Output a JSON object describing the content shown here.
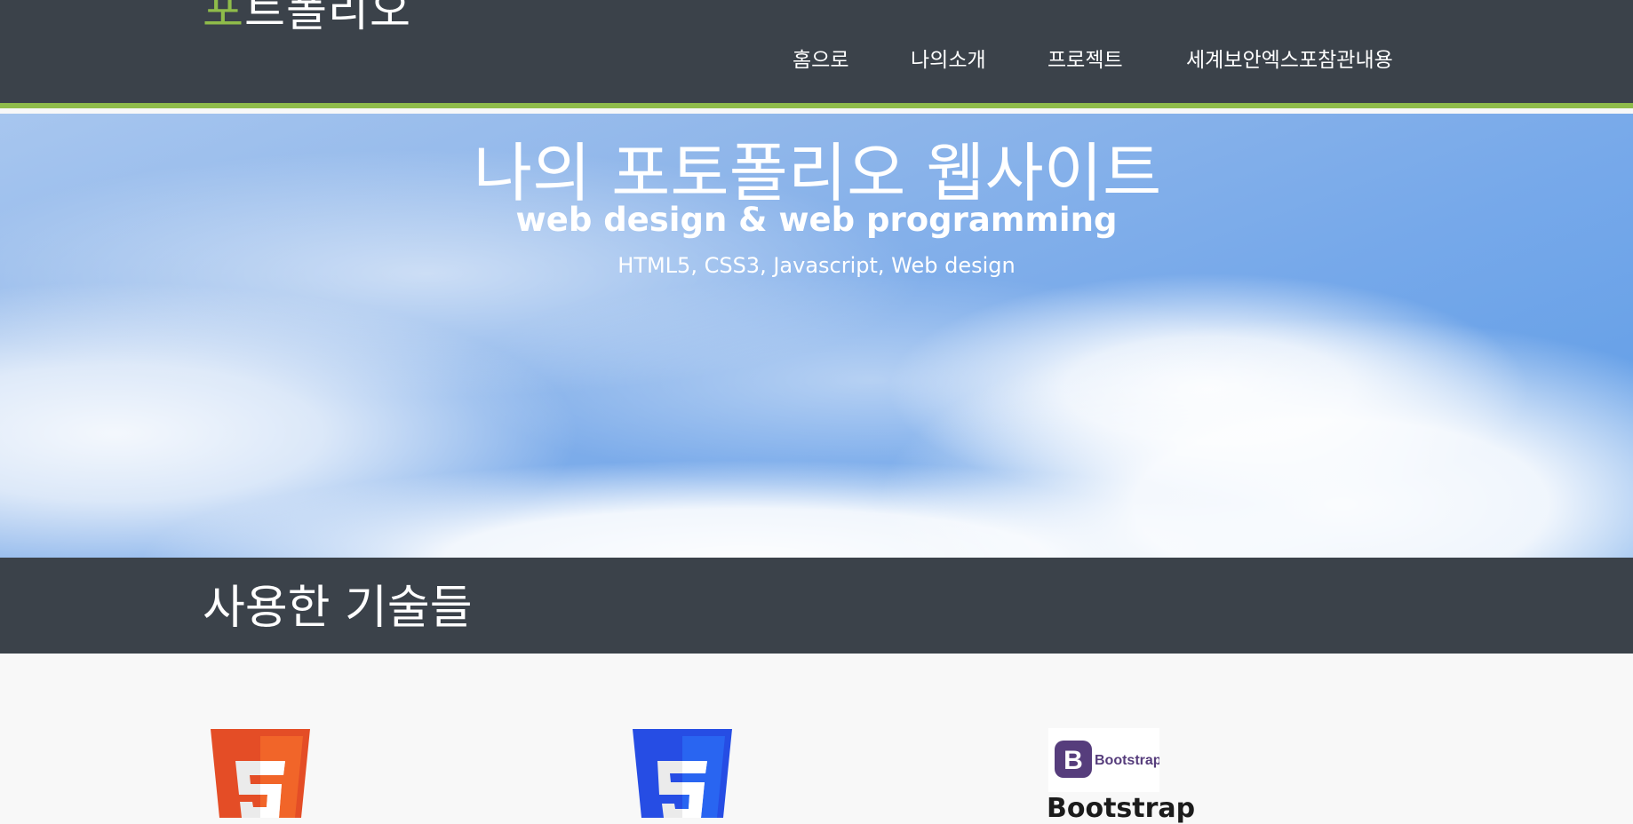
{
  "header": {
    "logo_accent": "포",
    "logo_rest": "트폴리오",
    "nav": [
      {
        "label": "홈으로"
      },
      {
        "label": "나의소개"
      },
      {
        "label": "프로젝트"
      },
      {
        "label": "세계보안엑스포참관내용"
      }
    ]
  },
  "hero": {
    "title": "나의 포토폴리오 웹사이트",
    "subtitle": "web design & web programming",
    "tags": "HTML5, CSS3, Javascript, Web design"
  },
  "section": {
    "title": "사용한 기술들"
  },
  "tech": {
    "items": [
      {
        "icon": "html5-logo-icon"
      },
      {
        "icon": "css3-logo-icon"
      },
      {
        "icon": "bootstrap-logo-icon",
        "logo_text": "Bootstrap",
        "caption": "Bootstrap"
      }
    ]
  },
  "colors": {
    "header_bg": "#3b424a",
    "accent": "#8fbc4a",
    "html5": "#e44d26",
    "css3": "#264de4",
    "bootstrap": "#563d7c"
  }
}
